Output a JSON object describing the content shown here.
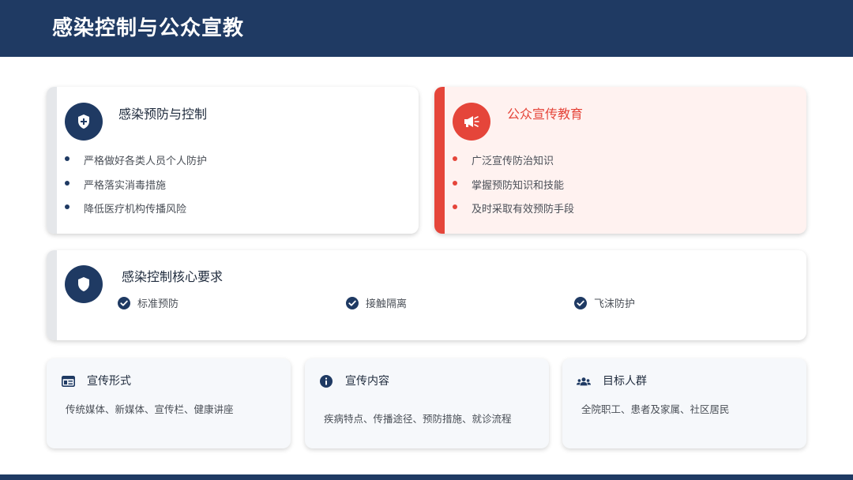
{
  "header": {
    "title": "感染控制与公众宣教"
  },
  "colors": {
    "navy": "#1f3a63",
    "red": "#e5453a",
    "gray_accent": "#e5e7ea",
    "pink_bg": "#fff2f0"
  },
  "prevention": {
    "title": "感染预防与控制",
    "icon": "shield-plus-icon",
    "items": [
      "严格做好各类人员个人防护",
      "严格落实消毒措施",
      "降低医疗机构传播风险"
    ]
  },
  "public_education": {
    "title": "公众宣传教育",
    "icon": "megaphone-icon",
    "items": [
      "广泛宣传防治知识",
      "掌握预防知识和技能",
      "及时采取有效预防手段"
    ]
  },
  "core_requirements": {
    "title": "感染控制核心要求",
    "icon": "shield-icon",
    "items": [
      "标准预防",
      "接触隔离",
      "飞沫防护"
    ]
  },
  "info_cards": [
    {
      "title": "宣传形式",
      "icon": "newspaper-icon",
      "text": "传统媒体、新媒体、宣传栏、健康讲座"
    },
    {
      "title": "宣传内容",
      "icon": "info-icon",
      "text": "疾病特点、传播途径、预防措施、就诊流程"
    },
    {
      "title": "目标人群",
      "icon": "people-icon",
      "text": "全院职工、患者及家属、社区居民"
    }
  ]
}
